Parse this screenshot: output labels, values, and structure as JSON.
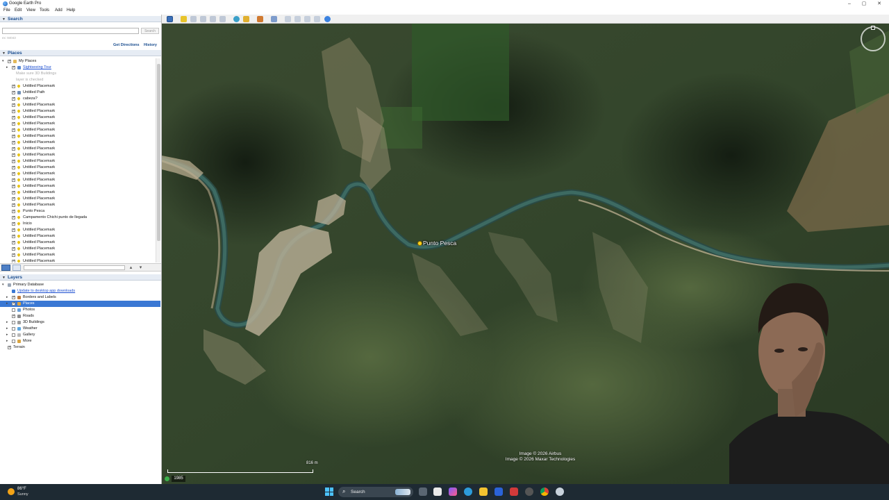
{
  "window": {
    "title": "Google Earth Pro",
    "controls": [
      "–",
      "▢",
      "✕"
    ]
  },
  "menu": [
    "File",
    "Edit",
    "View",
    "Tools",
    "Add",
    "Help"
  ],
  "search": {
    "header": "Search",
    "placeholder": "",
    "button": "Search",
    "hint": "ex: 94043",
    "get_directions": "Get Directions",
    "history": "History"
  },
  "places": {
    "header": "Places",
    "items": [
      {
        "label": "My Places",
        "style": "normal",
        "icon": "folder-icon",
        "expander": "▾",
        "checked": true,
        "indent": 0
      },
      {
        "label": "Sightseeing Tour",
        "style": "link",
        "icon": "tour-folder-icon",
        "expander": "▸",
        "checked": true,
        "indent": 1
      },
      {
        "label": "Make sure 3D Buildings",
        "style": "dim",
        "icon": "",
        "expander": "",
        "checked": null,
        "indent": 2
      },
      {
        "label": "layer is checked",
        "style": "dim",
        "icon": "",
        "expander": "",
        "checked": null,
        "indent": 2
      },
      {
        "label": "Untitled Placemark",
        "style": "normal",
        "icon": "placemark-icon",
        "expander": "",
        "checked": true,
        "indent": 1
      },
      {
        "label": "Untitled Path",
        "style": "normal",
        "icon": "path-icon",
        "expander": "",
        "checked": true,
        "indent": 1
      },
      {
        "label": "cabeza?",
        "style": "normal",
        "icon": "placemark-icon",
        "expander": "",
        "checked": true,
        "indent": 1
      },
      {
        "label": "Untitled Placemark",
        "style": "normal",
        "icon": "placemark-icon",
        "expander": "",
        "checked": true,
        "indent": 1
      },
      {
        "label": "Untitled Placemark",
        "style": "normal",
        "icon": "placemark-icon",
        "expander": "",
        "checked": true,
        "indent": 1
      },
      {
        "label": "Untitled Placemark",
        "style": "normal",
        "icon": "placemark-icon",
        "expander": "",
        "checked": true,
        "indent": 1
      },
      {
        "label": "Untitled Placemark",
        "style": "normal",
        "icon": "placemark-icon",
        "expander": "",
        "checked": true,
        "indent": 1
      },
      {
        "label": "Untitled Placemark",
        "style": "normal",
        "icon": "placemark-icon",
        "expander": "",
        "checked": true,
        "indent": 1
      },
      {
        "label": "Untitled Placemark",
        "style": "normal",
        "icon": "placemark-icon",
        "expander": "",
        "checked": true,
        "indent": 1
      },
      {
        "label": "Untitled Placemark",
        "style": "normal",
        "icon": "placemark-icon",
        "expander": "",
        "checked": true,
        "indent": 1
      },
      {
        "label": "Untitled Placemark",
        "style": "normal",
        "icon": "placemark-icon",
        "expander": "",
        "checked": true,
        "indent": 1
      },
      {
        "label": "Untitled Placemark",
        "style": "normal",
        "icon": "placemark-icon",
        "expander": "",
        "checked": true,
        "indent": 1
      },
      {
        "label": "Untitled Placemark",
        "style": "normal",
        "icon": "placemark-icon",
        "expander": "",
        "checked": true,
        "indent": 1
      },
      {
        "label": "Untitled Placemark",
        "style": "normal",
        "icon": "placemark-icon",
        "expander": "",
        "checked": true,
        "indent": 1
      },
      {
        "label": "Untitled Placemark",
        "style": "normal",
        "icon": "placemark-icon",
        "expander": "",
        "checked": true,
        "indent": 1
      },
      {
        "label": "Untitled Placemark",
        "style": "normal",
        "icon": "placemark-icon",
        "expander": "",
        "checked": true,
        "indent": 1
      },
      {
        "label": "Untitled Placemark",
        "style": "normal",
        "icon": "placemark-icon",
        "expander": "",
        "checked": true,
        "indent": 1
      },
      {
        "label": "Untitled Placemark",
        "style": "normal",
        "icon": "placemark-icon",
        "expander": "",
        "checked": true,
        "indent": 1
      },
      {
        "label": "Untitled Placemark",
        "style": "normal",
        "icon": "placemark-icon",
        "expander": "",
        "checked": true,
        "indent": 1
      },
      {
        "label": "Untitled Placemark",
        "style": "normal",
        "icon": "placemark-icon",
        "expander": "",
        "checked": true,
        "indent": 1
      },
      {
        "label": "Punto Pesca",
        "style": "normal",
        "icon": "placemark-icon",
        "expander": "",
        "checked": true,
        "indent": 1
      },
      {
        "label": "Campamento Chichi punto de llegada",
        "style": "normal",
        "icon": "placemark-icon",
        "expander": "",
        "checked": true,
        "indent": 1
      },
      {
        "label": "Inicio",
        "style": "normal",
        "icon": "placemark-icon",
        "expander": "",
        "checked": true,
        "indent": 1
      },
      {
        "label": "Untitled Placemark",
        "style": "normal",
        "icon": "placemark-icon",
        "expander": "",
        "checked": true,
        "indent": 1
      },
      {
        "label": "Untitled Placemark",
        "style": "normal",
        "icon": "placemark-icon",
        "expander": "",
        "checked": true,
        "indent": 1
      },
      {
        "label": "Untitled Placemark",
        "style": "normal",
        "icon": "placemark-icon",
        "expander": "",
        "checked": true,
        "indent": 1
      },
      {
        "label": "Untitled Placemark",
        "style": "normal",
        "icon": "placemark-icon",
        "expander": "",
        "checked": true,
        "indent": 1
      },
      {
        "label": "Untitled Placemark",
        "style": "normal",
        "icon": "placemark-icon",
        "expander": "",
        "checked": true,
        "indent": 1
      },
      {
        "label": "Untitled Placemark",
        "style": "normal",
        "icon": "placemark-icon",
        "expander": "",
        "checked": true,
        "indent": 1
      },
      {
        "label": "Untitled Placemark",
        "style": "normal",
        "icon": "placemark-icon",
        "expander": "",
        "checked": true,
        "indent": 1
      }
    ]
  },
  "layers": {
    "header": "Layers",
    "items": [
      {
        "label": "Primary Database",
        "style": "normal",
        "icon": "database-icon",
        "expander": "▾",
        "checked": null,
        "indent": 0,
        "selected": false
      },
      {
        "label": "Update to desktop app downloads",
        "style": "link",
        "icon": "info-icon",
        "expander": "",
        "checked": null,
        "indent": 1,
        "selected": false
      },
      {
        "label": "Borders and Labels",
        "style": "normal",
        "icon": "borders-icon",
        "expander": "▸",
        "checked": true,
        "indent": 1,
        "selected": false
      },
      {
        "label": "Places",
        "style": "normal",
        "icon": "places-layer-icon",
        "expander": "▸",
        "checked": true,
        "indent": 1,
        "selected": true
      },
      {
        "label": "Photos",
        "style": "normal",
        "icon": "photos-icon",
        "expander": "",
        "checked": false,
        "indent": 1,
        "selected": false
      },
      {
        "label": "Roads",
        "style": "normal",
        "icon": "roads-icon",
        "expander": "",
        "checked": true,
        "indent": 1,
        "selected": false
      },
      {
        "label": "3D Buildings",
        "style": "normal",
        "icon": "buildings-icon",
        "expander": "▸",
        "checked": false,
        "indent": 1,
        "selected": false
      },
      {
        "label": "Weather",
        "style": "normal",
        "icon": "weather-layer-icon",
        "expander": "▸",
        "checked": false,
        "indent": 1,
        "selected": false
      },
      {
        "label": "Gallery",
        "style": "normal",
        "icon": "gallery-icon",
        "expander": "▸",
        "checked": false,
        "indent": 1,
        "selected": false
      },
      {
        "label": "More",
        "style": "normal",
        "icon": "more-icon",
        "expander": "▸",
        "checked": false,
        "indent": 1,
        "selected": false
      },
      {
        "label": "Terrain",
        "style": "normal",
        "icon": "",
        "expander": "",
        "checked": true,
        "indent": 0,
        "selected": false
      }
    ]
  },
  "map": {
    "placemark_label": "Punto Pesca",
    "attribution_1": "Image © 2026 Airbus",
    "attribution_2": "Image © 2026 Maxar Technologies",
    "scale_label": "816 m",
    "year": "1985"
  },
  "taskbar": {
    "temperature": "86°F",
    "condition": "Sunny",
    "search_label": "Search"
  },
  "colors": {
    "panel_header": "#e6ecf4",
    "selection": "#3a78d4",
    "link": "#1a4dd0",
    "taskbar": "#1e2a33"
  }
}
